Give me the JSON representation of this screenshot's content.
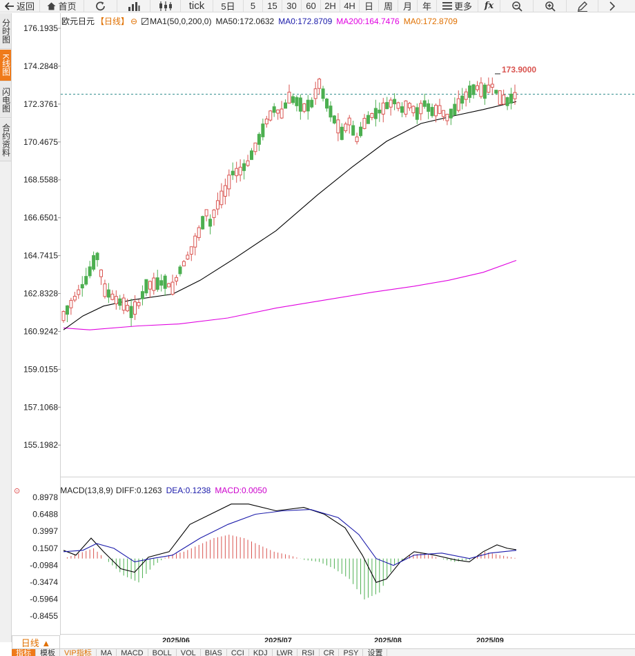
{
  "toolbar": {
    "back_label": "返回",
    "home_label": "首页",
    "tick_label": "tick",
    "periods": [
      "5日",
      "5",
      "15",
      "30",
      "60",
      "2H",
      "4H",
      "日",
      "周",
      "月",
      "年"
    ],
    "more_label": "更多"
  },
  "sidebar": {
    "tabs": [
      {
        "label": "分时图",
        "active": false
      },
      {
        "label": "K线图",
        "active": true
      },
      {
        "label": "闪电图",
        "active": false
      },
      {
        "label": "合约资料",
        "active": false
      }
    ]
  },
  "legend_main": {
    "symbol": "欧元日元",
    "period_tag": "【日线】",
    "ma_group": "MA1(50,0,200,0)",
    "ma50": "MA50:172.0632",
    "ma0_a": "MA0:172.8709",
    "ma200": "MA200:164.7476",
    "ma0_b": "MA0:172.8709"
  },
  "legend_macd": {
    "name": "MACD(13,8,9)",
    "diff": "DIFF:0.1263",
    "dea": "DEA:0.1238",
    "macd": "MACD:0.0050"
  },
  "period_select": "日线 ▲",
  "bottom_tabs": [
    "指标",
    "模板",
    "VIP指标",
    "MA",
    "MACD",
    "BOLL",
    "VOL",
    "BIAS",
    "CCI",
    "KDJ",
    "LWR",
    "RSI",
    "CR",
    "PSY",
    "设置"
  ],
  "colors": {
    "up": "#d9534f",
    "down": "#4caf50",
    "ma50": "#000000",
    "ma200": "#e000e0",
    "dea": "#1a1aaa",
    "macd_text": "#cc00cc",
    "accent": "#ef7a1a",
    "ref_line": "#2a8a8a"
  },
  "chart_data": {
    "type": "candlestick",
    "y_ticks": [
      "176.1935",
      "174.2848",
      "172.3761",
      "170.4675",
      "168.5588",
      "166.6501",
      "164.7415",
      "162.8328",
      "160.9242",
      "159.0155",
      "157.1068",
      "155.1982"
    ],
    "ylim": [
      155.1982,
      176.1935
    ],
    "x_labels": [
      "2025/06",
      "2025/07",
      "2025/08",
      "2025/09"
    ],
    "high_annotation": "173.9000",
    "ref_price": 172.8709,
    "macd_ticks": [
      "0.8978",
      "0.6488",
      "0.3997",
      "0.1507",
      "-0.0984",
      "-0.3474",
      "-0.5964",
      "-0.8455"
    ],
    "macd_ylim": [
      -0.8455,
      0.8978
    ]
  }
}
